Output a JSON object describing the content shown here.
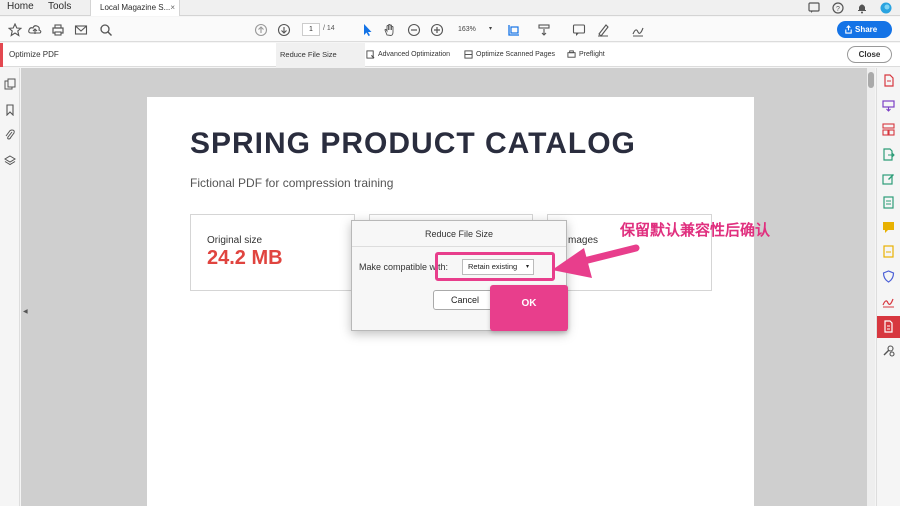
{
  "tabs": {
    "home": "Home",
    "tools": "Tools",
    "document": "Local Magazine S...",
    "document_close": "×"
  },
  "toolbar": {
    "page_current": "1",
    "page_total": "/ 14",
    "zoom": "163%",
    "share_label": "Share"
  },
  "optimize_bar": {
    "title": "Optimize PDF",
    "tab_reduce": "Reduce File Size",
    "tab_advanced": "Advanced Optimization",
    "tab_scanned": "Optimize Scanned Pages",
    "tab_preflight": "Preflight",
    "close_label": "Close"
  },
  "document": {
    "title": "SPRING PRODUCT CATALOG",
    "subtitle": "Fictional PDF for compression training",
    "card1_label": "Original size",
    "card1_value": "24.2 MB",
    "card3_label": "mages"
  },
  "dialog": {
    "title": "Reduce File Size",
    "compat_label": "Make compatible with:",
    "compat_value": "Retain existing",
    "cancel_label": "Cancel",
    "ok_label": "OK"
  },
  "annotation": {
    "text": "保留默认兼容性后确认",
    "color": "#e83e8c"
  },
  "colors": {
    "accent_blue": "#1473e6",
    "active_red": "#d7373f",
    "value_red": "#e0443f"
  }
}
